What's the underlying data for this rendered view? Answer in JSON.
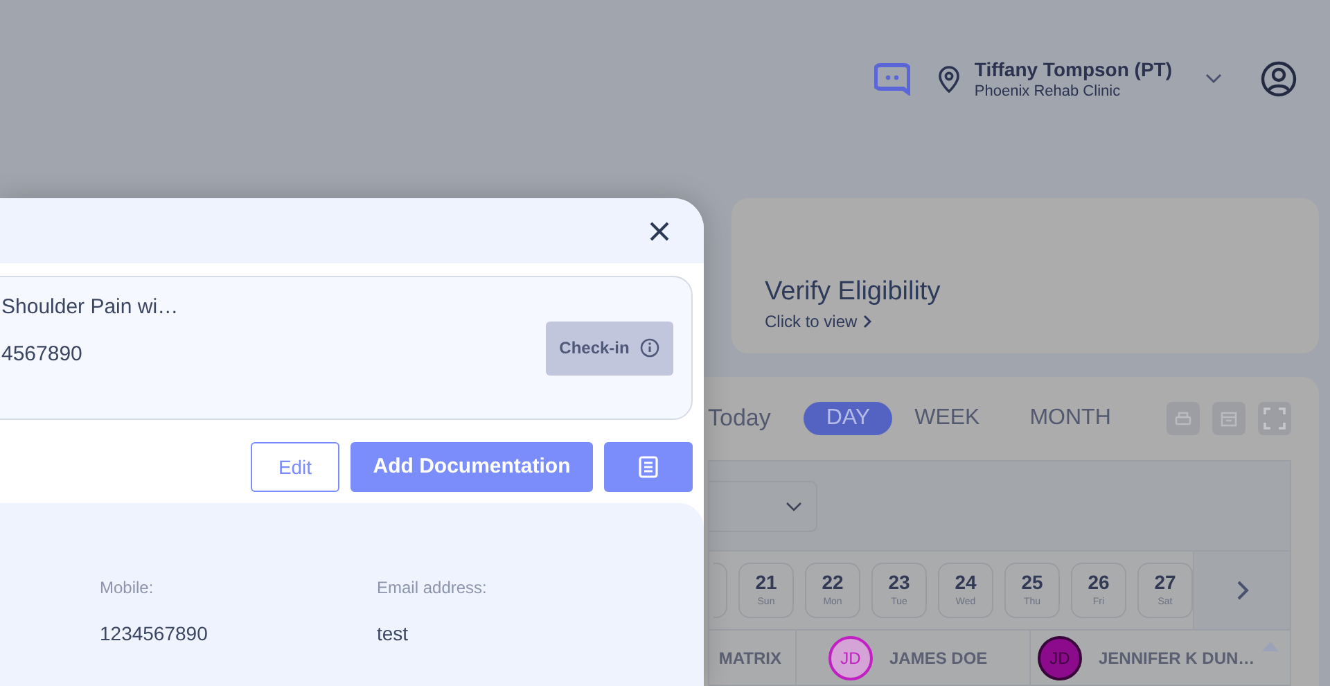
{
  "header": {
    "user_name": "Tiffany Tompson (PT)",
    "clinic": "Phoenix Rehab Clinic"
  },
  "eligibility_card": {
    "title": "Verify Eligibility",
    "link": "Click to view"
  },
  "calendar": {
    "today": "Today",
    "views": [
      {
        "label": "DAY",
        "selected": true
      },
      {
        "label": "WEEK",
        "selected": false
      },
      {
        "label": "MONTH",
        "selected": false
      }
    ],
    "days": [
      {
        "date": "21",
        "weekday": "Sun"
      },
      {
        "date": "22",
        "weekday": "Mon"
      },
      {
        "date": "23",
        "weekday": "Tue"
      },
      {
        "date": "24",
        "weekday": "Wed"
      },
      {
        "date": "25",
        "weekday": "Thu"
      },
      {
        "date": "26",
        "weekday": "Fri"
      },
      {
        "date": "27",
        "weekday": "Sat"
      }
    ],
    "providers": [
      {
        "kind": "text",
        "name": "MATRIX"
      },
      {
        "kind": "avatar",
        "initials": "JD",
        "name": "JAMES DOE",
        "color": "#c21fc4",
        "filled": false
      },
      {
        "kind": "avatar",
        "initials": "JD",
        "name": "JENNIFER K DUN…",
        "color": "#8c0a8c",
        "filled": true
      }
    ]
  },
  "modal": {
    "title_line": "Shoulder Pain wi…",
    "phone_line": "4567890",
    "check_in": {
      "label": "Check-in",
      "disabled": true
    },
    "actions": [
      "Edit",
      "Add Documentation"
    ],
    "contact": [
      {
        "label": "Mobile:",
        "value": "1234567890"
      },
      {
        "label": "Email address:",
        "value": "test"
      }
    ]
  }
}
